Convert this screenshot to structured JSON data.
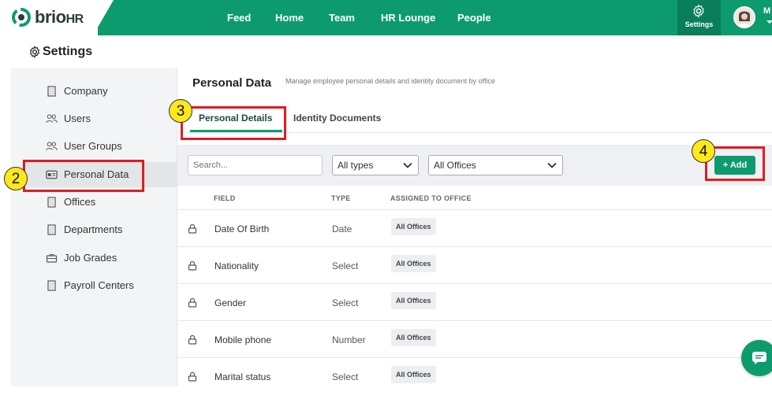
{
  "app": {
    "brand": "brio",
    "brand_suffix": "HR"
  },
  "nav": {
    "items": [
      "Feed",
      "Home",
      "Team",
      "HR Lounge",
      "People"
    ],
    "settings_label": "Settings",
    "user_initial": "M"
  },
  "page": {
    "title": "Settings"
  },
  "sidebar": {
    "items": [
      {
        "label": "Company",
        "icon": "building-icon"
      },
      {
        "label": "Users",
        "icon": "users-icon"
      },
      {
        "label": "User Groups",
        "icon": "users-icon"
      },
      {
        "label": "Personal Data",
        "icon": "id-card-icon",
        "active": true
      },
      {
        "label": "Offices",
        "icon": "building-icon"
      },
      {
        "label": "Departments",
        "icon": "building-icon"
      },
      {
        "label": "Job Grades",
        "icon": "briefcase-icon"
      },
      {
        "label": "Payroll Centers",
        "icon": "building-icon"
      }
    ]
  },
  "main": {
    "title": "Personal Data",
    "description": "Manage employee personal details and identity document by office",
    "tabs": [
      "Personal Details",
      "Identity Documents"
    ],
    "search_placeholder": "Search...",
    "type_filter": "All types",
    "office_filter": "All Offices",
    "add_label": "+ Add",
    "columns": [
      "FIELD",
      "TYPE",
      "ASSIGNED TO OFFICE"
    ],
    "rows": [
      {
        "field": "Date Of Birth",
        "type": "Date",
        "office": "All Offices"
      },
      {
        "field": "Nationality",
        "type": "Select",
        "office": "All Offices"
      },
      {
        "field": "Gender",
        "type": "Select",
        "office": "All Offices"
      },
      {
        "field": "Mobile phone",
        "type": "Number",
        "office": "All Offices"
      },
      {
        "field": "Marital status",
        "type": "Select",
        "office": "All Offices"
      }
    ]
  },
  "annotations": [
    "2",
    "3",
    "4"
  ],
  "colors": {
    "brand_green": "#0d9b6e",
    "highlight_red": "#e01b22",
    "callout_yellow": "#ffe81a"
  }
}
